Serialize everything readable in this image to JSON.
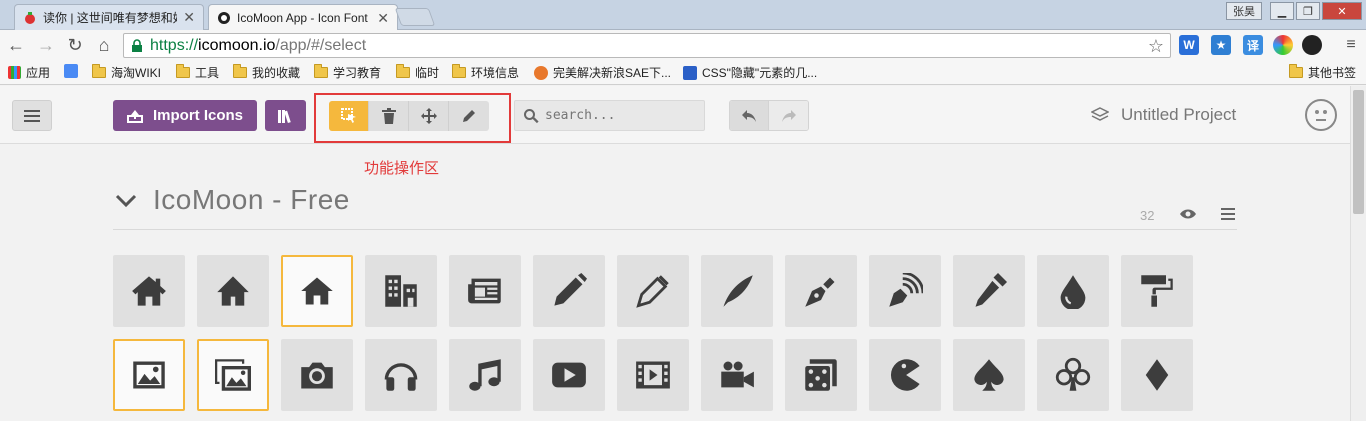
{
  "browser": {
    "tabs": [
      {
        "title": "读你 | 这世间唯有梦想和好姑娘",
        "close": "✕"
      },
      {
        "title": "IcoMoon App - Icon Font",
        "close": "✕"
      }
    ],
    "window_user": "张昊",
    "address": {
      "scheme": "https://",
      "host": "icomoon.io",
      "path": "/app/#/select"
    },
    "extensions": [
      "W",
      "译"
    ],
    "bookmarks": {
      "apps": "应用",
      "items": [
        "海淘WIKI",
        "工具",
        "我的收藏",
        "学习教育",
        "临时",
        "环境信息",
        "完美解决新浪SAE下...",
        "CSS\"隐藏\"元素的几..."
      ],
      "other": "其他书签"
    }
  },
  "app": {
    "import_label": "Import Icons",
    "search_placeholder": "search...",
    "project_name": "Untitled Project",
    "annotation": "功能操作区",
    "set": {
      "title": "IcoMoon - Free",
      "count": "32"
    },
    "icons": {
      "row1": [
        "home",
        "home2",
        "home3",
        "office",
        "newspaper",
        "pencil",
        "pencil2",
        "quill",
        "pen",
        "blog",
        "eyedropper",
        "droplet",
        "paint-format"
      ],
      "row2": [
        "image",
        "images",
        "camera",
        "headphones",
        "music",
        "play",
        "film",
        "video-camera",
        "dice",
        "pacman",
        "spades",
        "clubs",
        "diamonds"
      ],
      "selected": [
        "home3",
        "image",
        "images"
      ]
    },
    "colors": {
      "accent": "#f5b83d",
      "brand": "#7d4e8d",
      "annotation": "#e23a3a"
    }
  }
}
